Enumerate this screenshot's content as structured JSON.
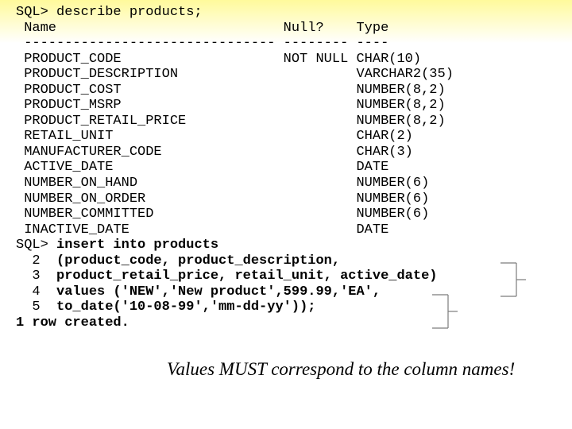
{
  "describe": {
    "prompt": "SQL> describe products;",
    "header": " Name                            Null?    Type",
    "sep": " ------------------------------- -------- ----",
    "rows": [
      " PRODUCT_CODE                    NOT NULL CHAR(10)",
      " PRODUCT_DESCRIPTION                      VARCHAR2(35)",
      " PRODUCT_COST                             NUMBER(8,2)",
      " PRODUCT_MSRP                             NUMBER(8,2)",
      " PRODUCT_RETAIL_PRICE                     NUMBER(8,2)",
      " RETAIL_UNIT                              CHAR(2)",
      " MANUFACTURER_CODE                        CHAR(3)",
      " ACTIVE_DATE                              DATE",
      " NUMBER_ON_HAND                           NUMBER(6)",
      " NUMBER_ON_ORDER                          NUMBER(6)",
      " NUMBER_COMMITTED                         NUMBER(6)",
      " INACTIVE_DATE                            DATE"
    ]
  },
  "insert": {
    "line1": {
      "prefix": "SQL> ",
      "text": "insert into products"
    },
    "line2": {
      "prefix": "  2  ",
      "text": "(product_code, product_description,"
    },
    "line3": {
      "prefix": "  3  ",
      "text": "product_retail_price, retail_unit, active_date)"
    },
    "line4": {
      "prefix": "  4  ",
      "text": "values ('NEW','New product',599.99,'EA',"
    },
    "line5": {
      "prefix": "  5  ",
      "text": "to_date('10-08-99','mm-dd-yy'));"
    }
  },
  "result": "1 row created.",
  "note": "Values MUST correspond to the column names!"
}
